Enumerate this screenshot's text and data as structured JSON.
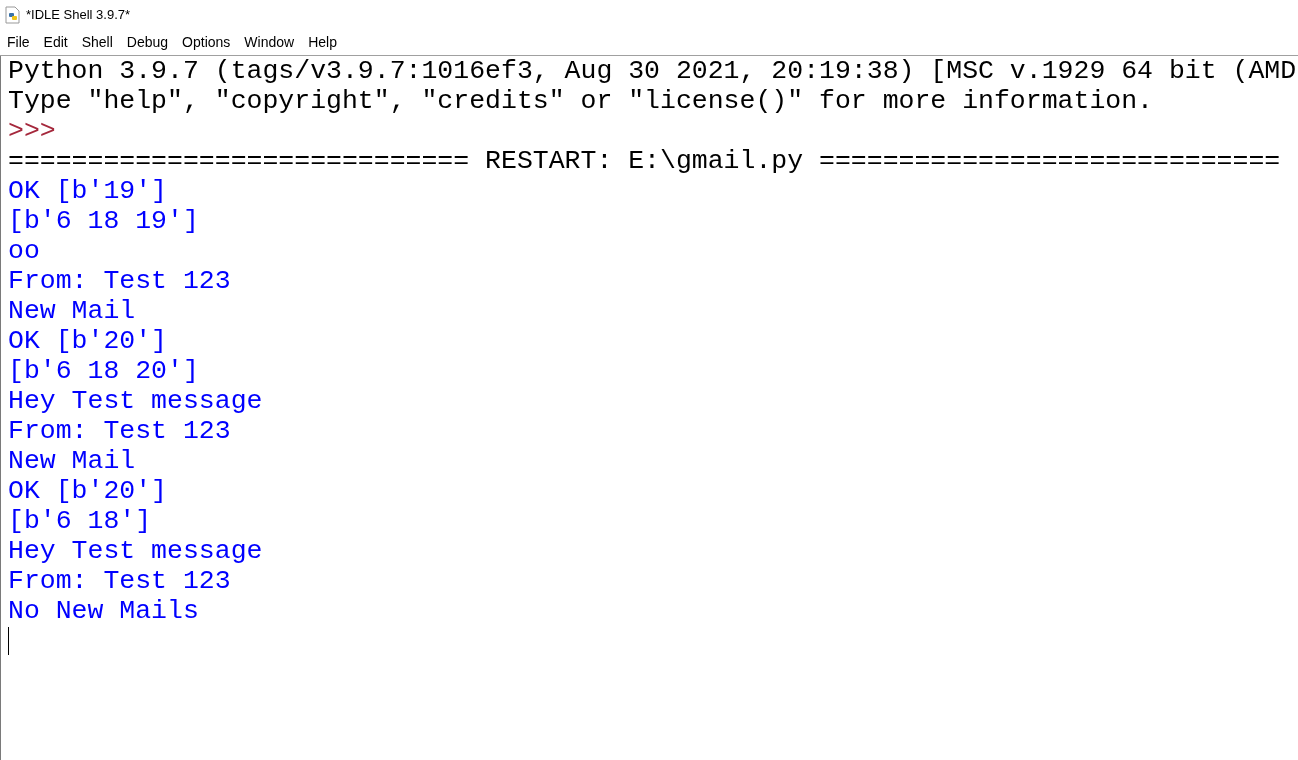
{
  "window": {
    "title": "*IDLE Shell 3.9.7*"
  },
  "menu": [
    "File",
    "Edit",
    "Shell",
    "Debug",
    "Options",
    "Window",
    "Help"
  ],
  "shell_lines": [
    {
      "kind": "console",
      "text": "Python 3.9.7 (tags/v3.9.7:1016ef3, Aug 30 2021, 20:19:38) [MSC v.1929 64 bit (AMD"
    },
    {
      "kind": "console",
      "text": "Type \"help\", \"copyright\", \"credits\" or \"license()\" for more information."
    },
    {
      "kind": "prompt",
      "text": ">>>"
    },
    {
      "kind": "console",
      "text": "============================= RESTART: E:\\gmail.py ============================="
    },
    {
      "kind": "stdout",
      "text": "OK [b'19']"
    },
    {
      "kind": "stdout",
      "text": "[b'6 18 19']"
    },
    {
      "kind": "stdout",
      "text": "oo"
    },
    {
      "kind": "stdout",
      "text": "From: Test 123"
    },
    {
      "kind": "stdout",
      "text": "New Mail"
    },
    {
      "kind": "stdout",
      "text": "OK [b'20']"
    },
    {
      "kind": "stdout",
      "text": "[b'6 18 20']"
    },
    {
      "kind": "stdout",
      "text": "Hey Test message"
    },
    {
      "kind": "stdout",
      "text": "From: Test 123"
    },
    {
      "kind": "stdout",
      "text": "New Mail"
    },
    {
      "kind": "stdout",
      "text": "OK [b'20']"
    },
    {
      "kind": "stdout",
      "text": "[b'6 18']"
    },
    {
      "kind": "stdout",
      "text": "Hey Test message"
    },
    {
      "kind": "stdout",
      "text": "From: Test 123"
    },
    {
      "kind": "stdout",
      "text": "No New Mails"
    }
  ]
}
